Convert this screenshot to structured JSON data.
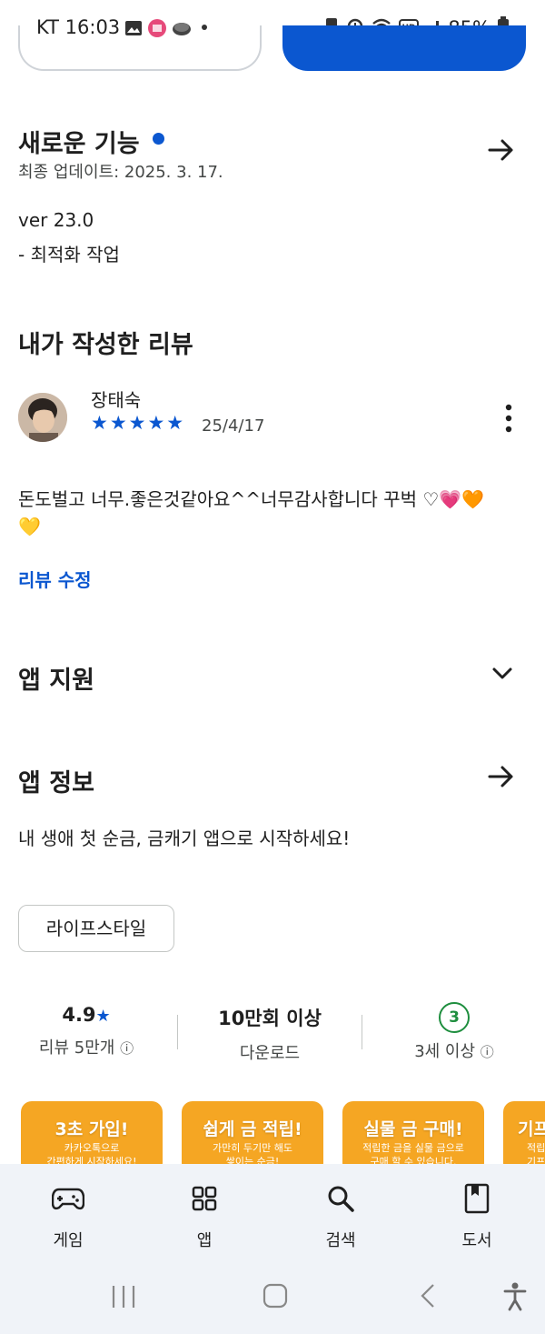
{
  "status_bar": {
    "carrier_time": "KT 16:03",
    "battery": "85%"
  },
  "whats_new": {
    "title": "새로운 기능",
    "updated": "최종 업데이트: 2025. 3. 17.",
    "version": "ver 23.0",
    "notes": "- 최적화 작업"
  },
  "my_review": {
    "section_title": "내가 작성한 리뷰",
    "reviewer": "장태숙",
    "stars": "★★★★★",
    "rating": 5,
    "date": "25/4/17",
    "text_line1": "돈도벌고 너무.좋은것같아요^^너무감사합니다 꾸벅 ♡💗🧡",
    "text_line2": "💛",
    "edit_label": "리뷰 수정"
  },
  "app_support": {
    "title": "앱 지원"
  },
  "app_info": {
    "title": "앱 정보",
    "description": "내 생애 첫 순금, 금캐기 앱으로 시작하세요!",
    "category_chip": "라이프스타일"
  },
  "stats": {
    "rating_value": "4.9",
    "rating_star": "★",
    "rating_label": "리뷰 5만개",
    "downloads_value": "10만회 이상",
    "downloads_label": "다운로드",
    "age_badge": "3",
    "age_label": "3세 이상",
    "info_glyph": "ⓘ"
  },
  "promos": [
    {
      "title": "3초 가입!",
      "line1": "카카오톡으로",
      "line2": "간편하게 시작하세요!"
    },
    {
      "title": "쉽게 금 적립!",
      "line1": "가만히 두기만 해도",
      "line2": "쌓이는 순금!"
    },
    {
      "title": "실물 금 구매!",
      "line1": "적립한 금을 실물 금으로",
      "line2": "구매 할 수 있습니다."
    },
    {
      "title": "기프",
      "line1": "적립",
      "line2": "기프"
    }
  ],
  "bottom_nav": {
    "games": "게임",
    "apps": "앱",
    "search": "검색",
    "books": "도서"
  },
  "colors": {
    "accent": "#0b57d0",
    "promo": "#f5a623",
    "age_green": "#1e8e3e"
  }
}
